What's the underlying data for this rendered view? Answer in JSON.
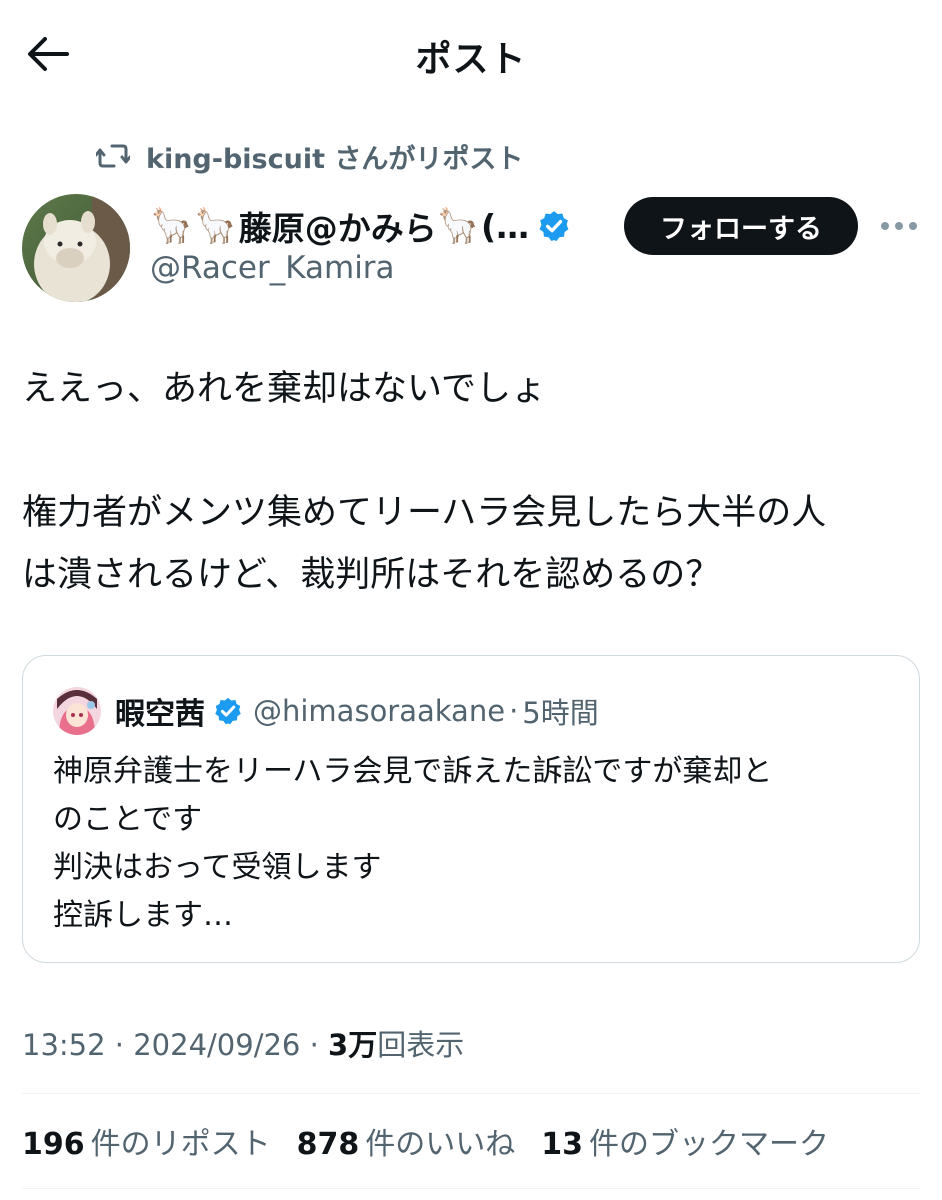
{
  "header": {
    "title": "ポスト"
  },
  "repost": {
    "text": "king-biscuit さんがリポスト"
  },
  "author": {
    "llama_emoji": "🦙",
    "display_name": "藤原@かみら",
    "display_suffix": "(…",
    "handle": "@Racer_Kamira",
    "verified": true
  },
  "follow_button": {
    "label": "フォローする"
  },
  "tweet": {
    "lines": [
      "ええっ、あれを棄却はないでしょ",
      "",
      "権力者がメンツ集めてリーハラ会見したら大半の人",
      "は潰されるけど、裁判所はそれを認めるの？"
    ]
  },
  "quote": {
    "name": "暇空茜",
    "handle": "@himasoraakane",
    "dot": "·",
    "time": "5時間",
    "verified": true,
    "lines": [
      "神原弁護士をリーハラ会見で訴えた訴訟ですが棄却と",
      "のことです",
      "判決はおって受領します",
      "控訴します…"
    ]
  },
  "meta": {
    "time": "13:52",
    "sep1": " · ",
    "date": "2024/09/26",
    "sep2": " · ",
    "views_count": "3万",
    "views_label": "回表示"
  },
  "stats": {
    "reposts_count": "196",
    "reposts_label": "件のリポスト",
    "likes_count": "878",
    "likes_label": "件のいいね",
    "bookmarks_count": "13",
    "bookmarks_label": "件のブックマーク"
  },
  "colors": {
    "text": "#0f1419",
    "secondary": "#536471",
    "verified_blue": "#1d9bf0",
    "border": "#cfd9de"
  },
  "icons": {
    "back": "arrow-left-icon",
    "repost": "repost-icon",
    "verified": "verified-badge-icon",
    "more": "more-dots-icon"
  }
}
